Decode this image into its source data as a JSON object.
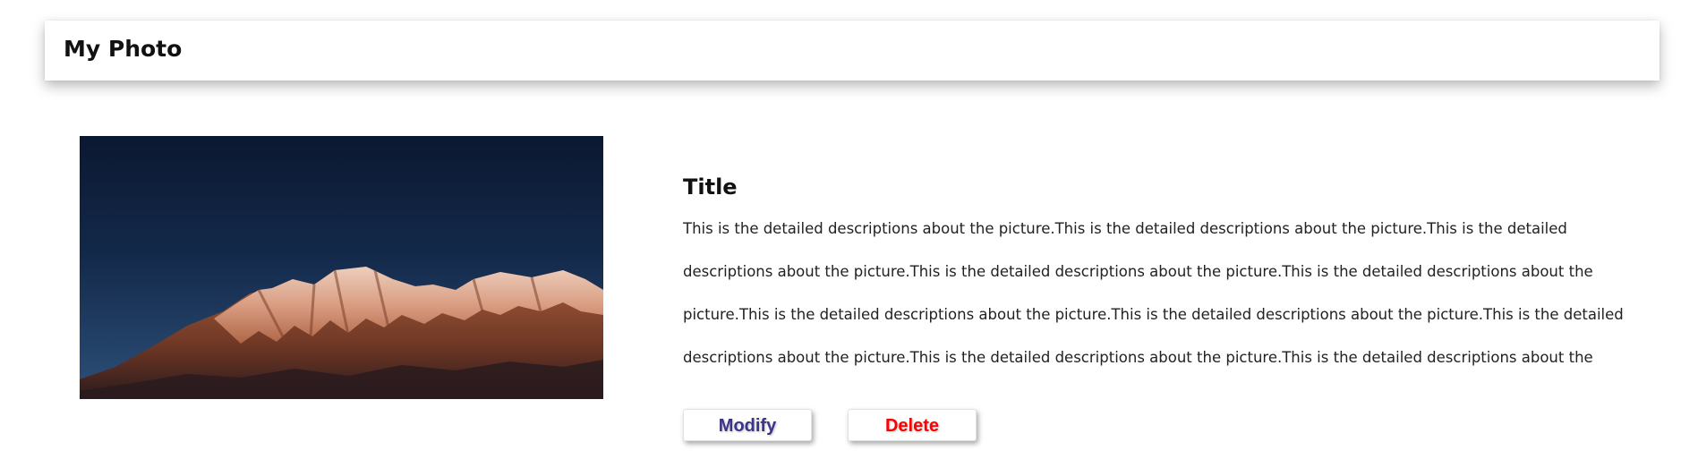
{
  "header": {
    "title": "My Photo"
  },
  "photo": {
    "subject": "snow-capped mountain range at dusk"
  },
  "detail": {
    "title": "Title",
    "description": "This is the detailed descriptions about the picture.This is the detailed descriptions about the picture.This is the detailed descriptions about the picture.This is the detailed descriptions about the picture.This is the detailed descriptions about the picture.This is the detailed descriptions about the picture.This is the detailed descriptions about the picture.This is the detailed descriptions about the picture.This is the detailed descriptions about the picture.This is the detailed descriptions about the picture.This is the detailed descriptions about the..."
  },
  "actions": {
    "modify_label": "Modify",
    "delete_label": "Delete"
  },
  "colors": {
    "modify_text": "#3c3488",
    "delete_text": "#ff0000"
  }
}
